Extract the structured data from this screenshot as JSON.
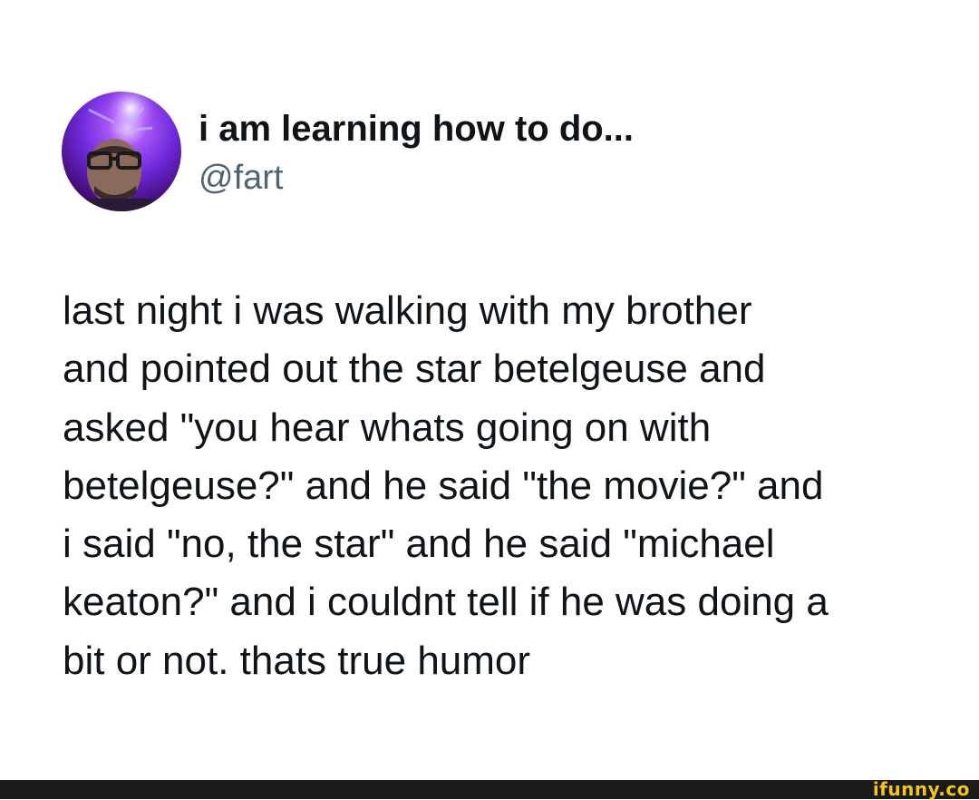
{
  "author": {
    "display_name": "i am learning how to do...",
    "handle": "@fart",
    "avatar_icon": "profile-photo"
  },
  "tweet": {
    "lines": [
      "last night i was walking with my brother",
      "and pointed out the star betelgeuse and",
      "asked \"you hear whats going on with",
      "betelgeuse?\" and he said \"the movie?\" and",
      "i said \"no, the star\" and he said \"michael",
      "keaton?\" and i couldnt tell if he was doing a",
      "bit or not. thats true humor"
    ]
  },
  "watermark": {
    "text": "ifunny.co",
    "color": "#f5c518"
  },
  "colors": {
    "text_primary": "#0f1419",
    "text_secondary": "#536471",
    "footer_bar": "#1a1a1a"
  }
}
